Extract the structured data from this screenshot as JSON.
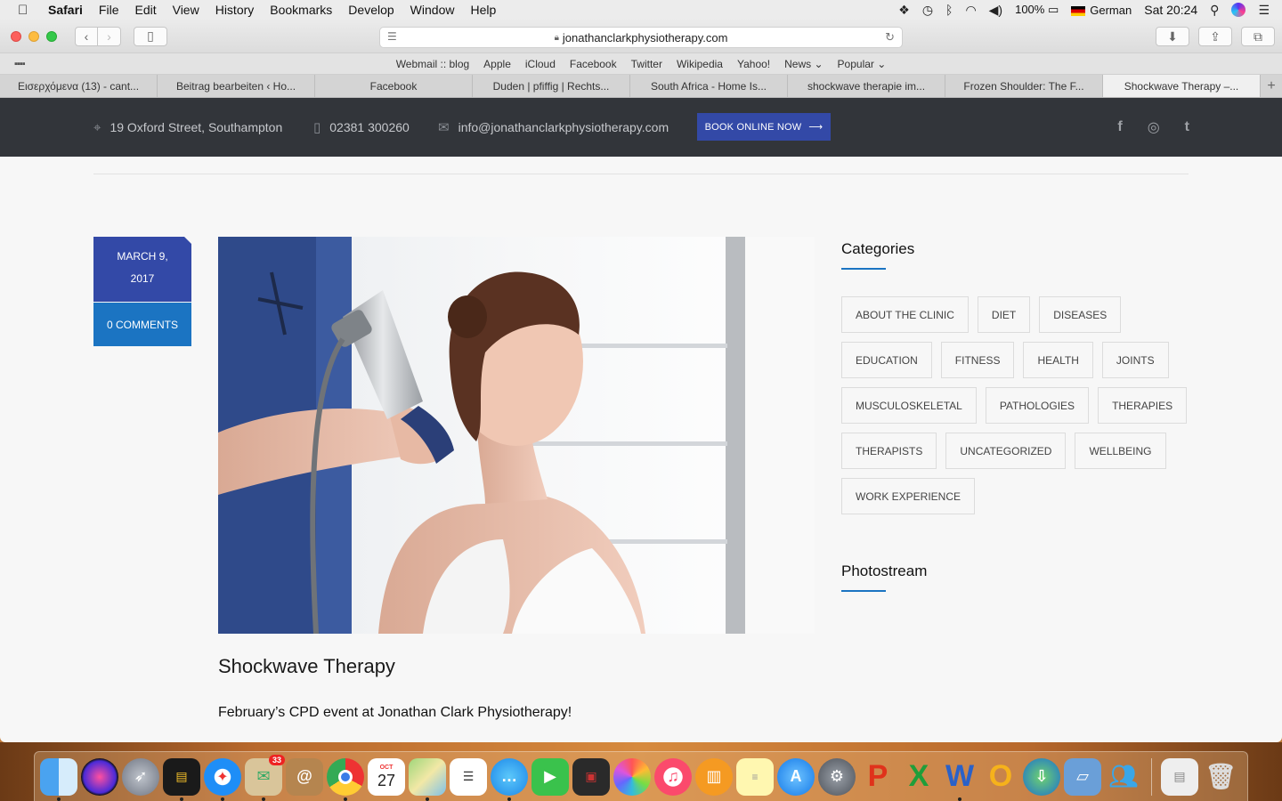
{
  "menubar": {
    "app": "Safari",
    "items": [
      "File",
      "Edit",
      "View",
      "History",
      "Bookmarks",
      "Develop",
      "Window",
      "Help"
    ],
    "battery": "100%",
    "language": "German",
    "clock": "Sat 20:24"
  },
  "browser": {
    "url": "jonathanclarkphysiotherapy.com",
    "bookmarks": [
      "Webmail :: blog",
      "Apple",
      "iCloud",
      "Facebook",
      "Twitter",
      "Wikipedia",
      "Yahoo!",
      "News ⌄",
      "Popular ⌄"
    ],
    "tabs": [
      "Εισερχόμενα (13) - cant...",
      "Beitrag bearbeiten ‹ Ho...",
      "Facebook",
      "Duden | pfiffig | Rechts...",
      "South Africa - Home Is...",
      "shockwave therapie im...",
      "Frozen Shoulder: The F...",
      "Shockwave Therapy –..."
    ],
    "active_tab": 7
  },
  "site": {
    "address": "19 Oxford Street, Southampton",
    "phone": "02381 300260",
    "email": "info@jonathanclarkphysiotherapy.com",
    "book_button": "BOOK ONLINE NOW",
    "socials": [
      "f",
      "◎",
      "t"
    ]
  },
  "post": {
    "date_line1": "MARCH 9,",
    "date_line2": "2017",
    "comments": "0 COMMENTS",
    "title": "Shockwave Therapy",
    "excerpt": "February’s CPD event at Jonathan Clark Physiotherapy!"
  },
  "sidebar": {
    "categories_title": "Categories",
    "categories": [
      [
        "ABOUT THE CLINIC",
        "DIET",
        "DISEASES"
      ],
      [
        "EDUCATION",
        "FITNESS",
        "HEALTH",
        "JOINTS"
      ],
      [
        "MUSCULOSKELETAL",
        "PATHOLOGIES",
        "THERAPIES"
      ],
      [
        "THERAPISTS",
        "UNCATEGORIZED",
        "WELLBEING"
      ],
      [
        "WORK EXPERIENCE"
      ]
    ],
    "photostream_title": "Photostream"
  },
  "dock": {
    "mail_badge": "33",
    "calendar_month": "OCT",
    "calendar_day": "27"
  },
  "colors": {
    "accent_blue": "#3349a7",
    "comments_blue": "#1b74c2",
    "header_dark": "#32353a"
  }
}
